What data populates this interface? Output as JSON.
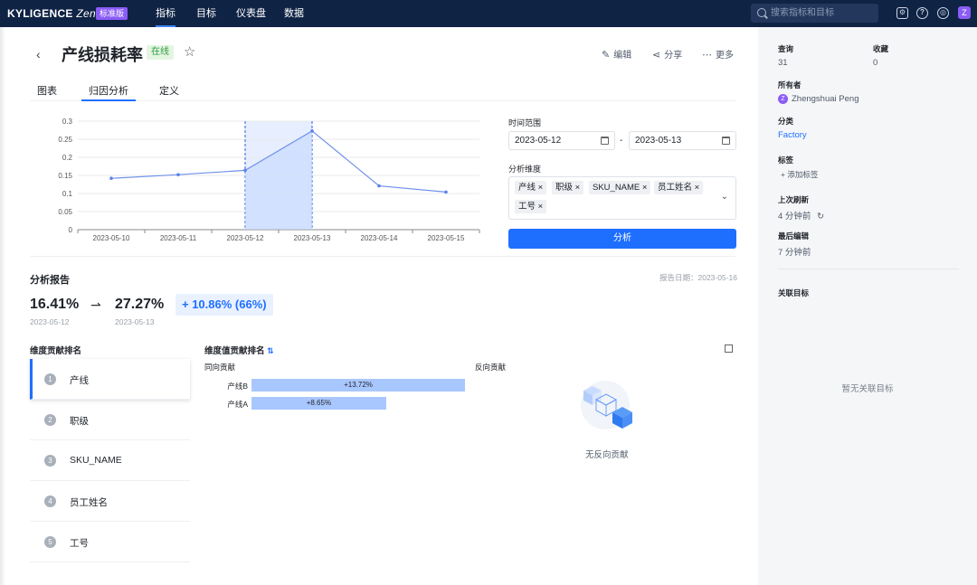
{
  "topnav": {
    "logo": "KYLIGENCE",
    "logo_suffix": "Zen",
    "plan_badge": "标准版",
    "items": [
      "指标",
      "目标",
      "仪表盘",
      "数据"
    ],
    "search_placeholder": "搜索指标和目标",
    "avatar_letter": "Z"
  },
  "header": {
    "title": "产线损耗率",
    "status": "在线",
    "actions": {
      "edit": "编辑",
      "share": "分享",
      "more": "更多"
    }
  },
  "tabs": [
    "图表",
    "归因分析",
    "定义"
  ],
  "chart_data": {
    "type": "line",
    "categories": [
      "2023-05-10",
      "2023-05-11",
      "2023-05-12",
      "2023-05-13",
      "2023-05-14",
      "2023-05-15"
    ],
    "values": [
      0.142,
      0.152,
      0.164,
      0.273,
      0.121,
      0.104
    ],
    "ylim": [
      0,
      0.3
    ],
    "yticks": [
      "0",
      "0.05",
      "0.1",
      "0.15",
      "0.2",
      "0.25",
      "0.3"
    ],
    "highlight_range": [
      "2023-05-12",
      "2023-05-13"
    ],
    "grid": true
  },
  "panel": {
    "time_range_label": "时间范围",
    "start_date": "2023-05-12",
    "end_date": "2023-05-13",
    "date_sep": "-",
    "dims_label": "分析维度",
    "dims": [
      "产线",
      "职级",
      "SKU_NAME",
      "员工姓名",
      "工号"
    ],
    "chip_close": "×",
    "analyze_button": "分析"
  },
  "report": {
    "title": "分析报告",
    "date_label": "报告日期：2023-05-16",
    "from_value": "16.41%",
    "from_date": "2023-05-12",
    "to_value": "27.27%",
    "to_date": "2023-05-13",
    "delta": "+ 10.86% (66%)",
    "dim_rank_label": "维度贡献排名",
    "value_rank_label": "维度值贡献排名",
    "positive_label": "同向贡献",
    "negative_label": "反向贡献",
    "dim_rank": [
      {
        "num": "1",
        "name": "产线"
      },
      {
        "num": "2",
        "name": "职级"
      },
      {
        "num": "3",
        "name": "SKU_NAME"
      },
      {
        "num": "4",
        "name": "员工姓名"
      },
      {
        "num": "5",
        "name": "工号"
      }
    ],
    "bars": [
      {
        "label": "产线B",
        "text": "+13.72%",
        "value": 13.72
      },
      {
        "label": "产线A",
        "text": "+8.65%",
        "value": 8.65
      }
    ],
    "negative_empty": "无反向贡献"
  },
  "sidebar": {
    "queries_label": "查询",
    "queries_value": "31",
    "favorites_label": "收藏",
    "favorites_value": "0",
    "owner_label": "所有者",
    "owner_initial": "Z",
    "owner_name": "Zhengshuai Peng",
    "category_label": "分类",
    "category_value": "Factory",
    "tags_label": "标签",
    "add_tag": "添加标签",
    "last_refresh_label": "上次刷新",
    "last_refresh_value": "4 分钟前",
    "last_edit_label": "最后编辑",
    "last_edit_value": "7 分钟前",
    "related_label": "关联目标",
    "related_empty": "暂无关联目标"
  }
}
